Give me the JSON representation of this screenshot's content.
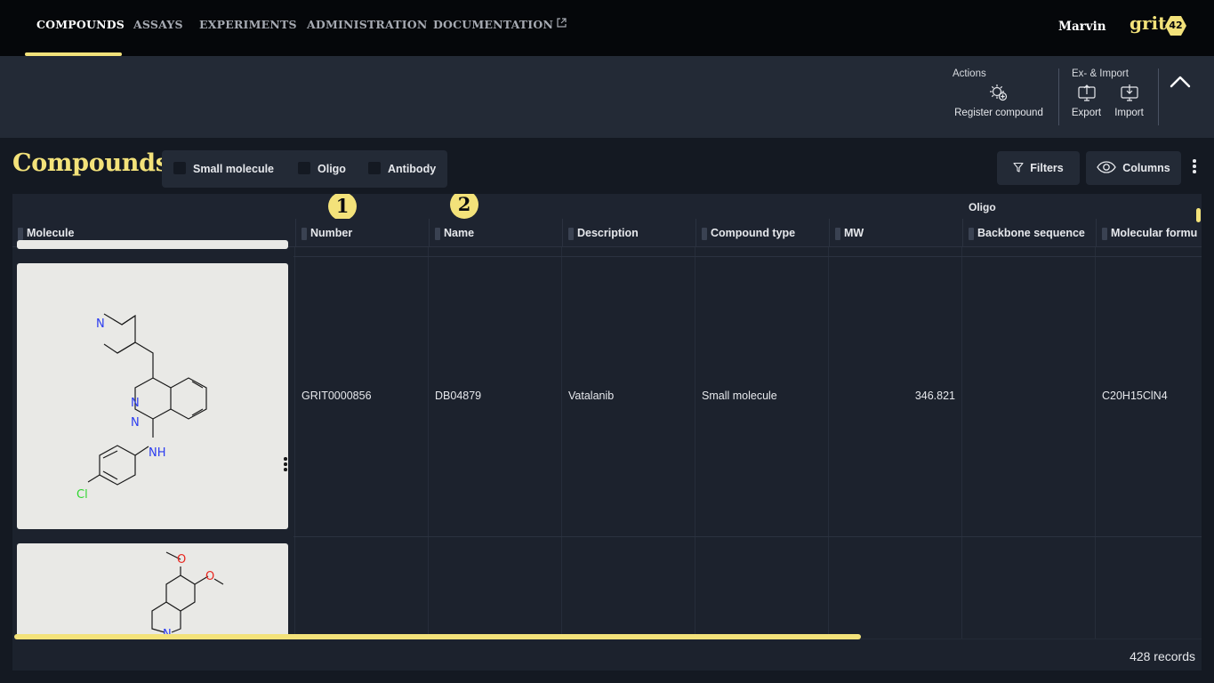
{
  "nav": {
    "items": [
      {
        "label": "COMPOUNDS",
        "active": true
      },
      {
        "label": "ASSAYS"
      },
      {
        "label": "EXPERIMENTS"
      },
      {
        "label": "ADMINISTRATION"
      },
      {
        "label": "DOCUMENTATION",
        "external_icon": "external-link-icon"
      }
    ],
    "user": "Marvin",
    "logo_text": "grit",
    "logo_badge": "42",
    "accent": "#f3e27a"
  },
  "actionbar": {
    "actions_title": "Actions",
    "register_label": "Register compound",
    "export_title": "Ex- & Import",
    "export_label": "Export",
    "import_label": "Import",
    "collapse_icon": "chevron-up-icon"
  },
  "page": {
    "title": "Compounds",
    "type_filters": [
      "Small molecule",
      "Oligo",
      "Antibody"
    ],
    "filters_label": "Filters",
    "columns_label": "Columns"
  },
  "grid": {
    "group_header": "Oligo",
    "columns": [
      "Molecule",
      "Number",
      "Name",
      "Description",
      "Compound type",
      "MW",
      "Backbone sequence",
      "Molecular formu"
    ],
    "badges": [
      "1",
      "2"
    ],
    "rows": [
      {
        "number": "GRIT0000856",
        "name": "DB04879",
        "description": "Vatalanib",
        "compound_type": "Small molecule",
        "mw": "346.821",
        "backbone_sequence": "",
        "molecular_formula": "C20H15ClN4"
      }
    ],
    "record_count": "428 records"
  }
}
